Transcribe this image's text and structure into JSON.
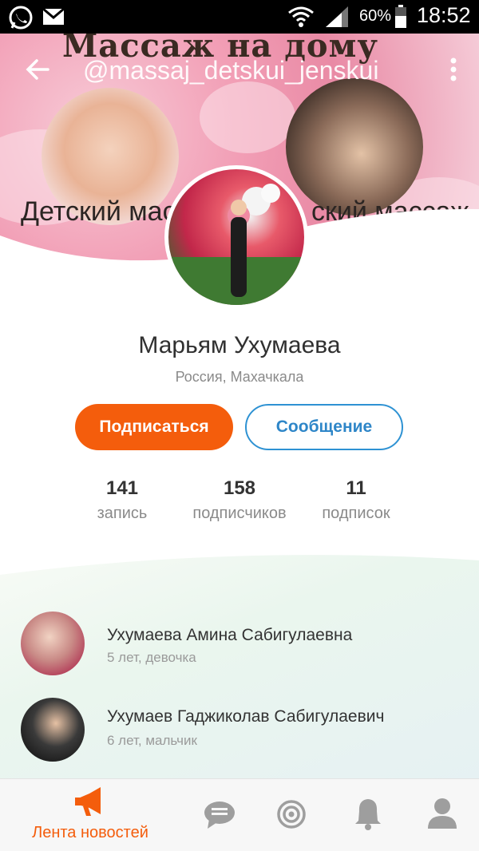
{
  "status_bar": {
    "battery": "60%",
    "time": "18:52",
    "icons": [
      "whatsapp-icon",
      "gmail-icon",
      "wifi-icon",
      "signal-icon",
      "battery-icon"
    ]
  },
  "cover": {
    "title_art": "Массаж на дому",
    "handle": "@massaj_detskui_jenskui",
    "left_label": "Детский мас",
    "right_label": "ский массаж"
  },
  "profile": {
    "name": "Марьям Ухумаева",
    "location": "Россия, Махачкала",
    "subscribe_label": "Подписаться",
    "message_label": "Сообщение"
  },
  "stats": [
    {
      "value": "141",
      "label": "запись"
    },
    {
      "value": "158",
      "label": "подписчиков"
    },
    {
      "value": "11",
      "label": "подписок"
    }
  ],
  "family": [
    {
      "name": "Ухумаева Амина Сабигулаевна",
      "details": "5 лет, девочка"
    },
    {
      "name": "Ухумаев  Гаджиколав Сабигулаевич",
      "details": "6 лет, мальчик"
    }
  ],
  "tabbar": {
    "active_label": "Лента новостей",
    "items": [
      "megaphone-icon",
      "chat-icon",
      "target-icon",
      "bell-icon",
      "profile-icon"
    ]
  },
  "colors": {
    "accent": "#f45d0c",
    "link_blue": "#2e86c8",
    "status_bar": "#000000"
  }
}
